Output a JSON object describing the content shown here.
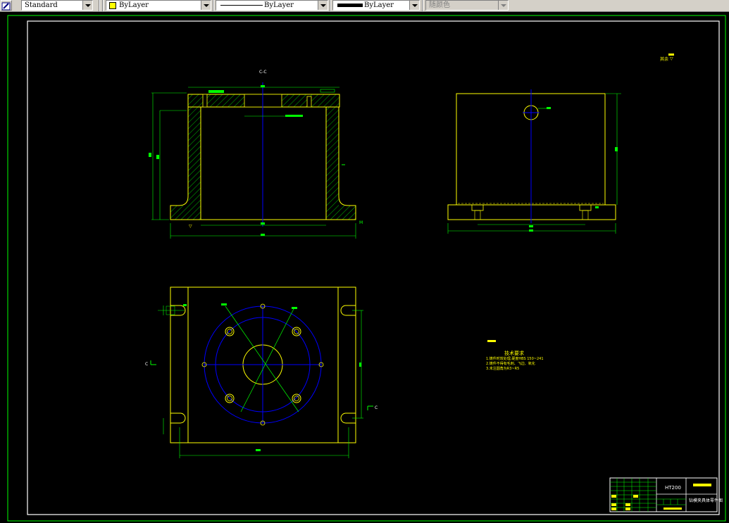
{
  "toolbar": {
    "text_style": "Standard",
    "layer_color": "ByLayer",
    "linetype": "ByLayer",
    "lineweight": "ByLayer",
    "plot_style": "随颜色",
    "layer_swatch_color": "#ffff00"
  },
  "drawing": {
    "section_label": "C-C",
    "roughness_label": "其余",
    "section_mark_c": "C",
    "notes": {
      "title": "技术要求",
      "items": [
        "1.铸件时效处理,硬度HBS 150~241",
        "2.铸件不得有毛刺、飞边、氧化",
        "3.未注圆角为R3~R5"
      ]
    },
    "title_block": {
      "material": "HT200",
      "part_name": "钻模夹具体零件图"
    }
  },
  "colors": {
    "background": "#000000",
    "outline": "#ffff00",
    "dimension": "#00ff00",
    "centerline": "#0000ff",
    "hatch": "#00ff00",
    "text": "#ffff00"
  }
}
